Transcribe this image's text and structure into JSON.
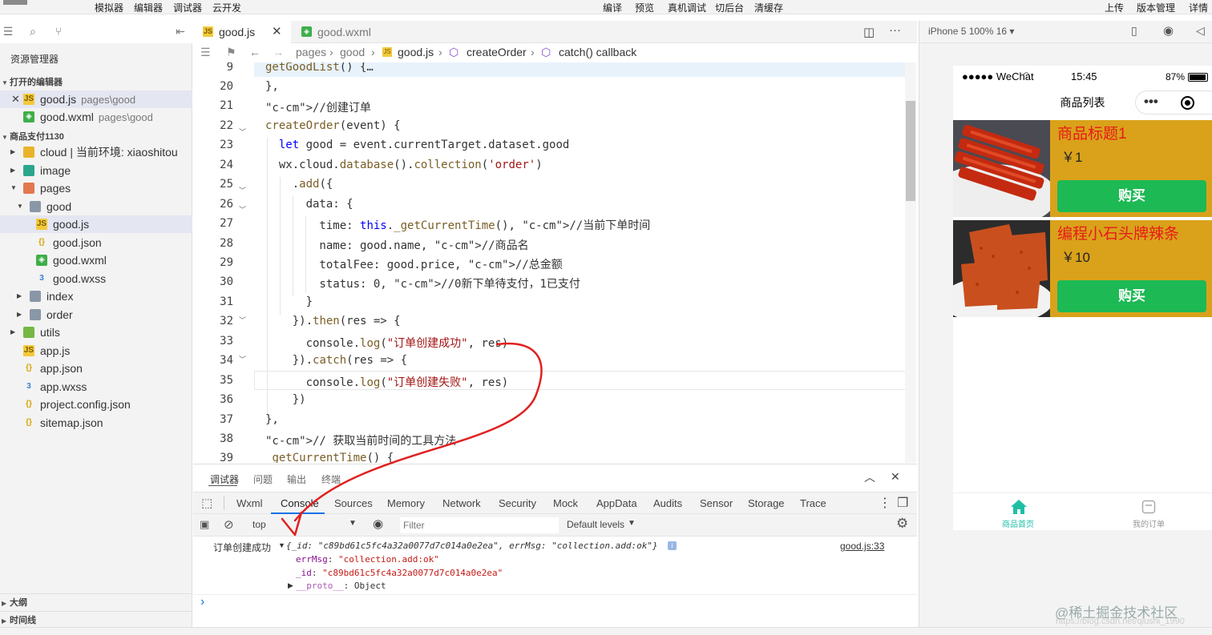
{
  "menu": [
    "模拟器",
    "编辑器",
    "调试器",
    "云开发",
    "编译",
    "预览",
    "真机调试",
    "切后台",
    "清缓存",
    "上传",
    "版本管理",
    "详情"
  ],
  "explorer": {
    "title": "资源管理器",
    "open_editors_label": "打开的编辑器",
    "open_editors": [
      {
        "name": "good.js",
        "path": "pages\\good"
      },
      {
        "name": "good.wxml",
        "path": "pages\\good"
      }
    ],
    "project_label": "商品支付1130",
    "tree": [
      "cloud | 当前环境: xiaoshitou",
      "image",
      "pages",
      "good",
      "good.js",
      "good.json",
      "good.wxml",
      "good.wxss",
      "index",
      "order",
      "utils",
      "app.js",
      "app.json",
      "app.wxss",
      "project.config.json",
      "sitemap.json"
    ],
    "outline_label": "大纲",
    "timeline_label": "时间线"
  },
  "editor": {
    "tabs": [
      {
        "label": "good.js"
      },
      {
        "label": "good.wxml"
      }
    ],
    "breadcrumb": [
      "pages",
      "good",
      "good.js",
      "createOrder",
      "catch() callback"
    ],
    "line_numbers": [
      "9",
      "20",
      "21",
      "22",
      "23",
      "24",
      "25",
      "26",
      "27",
      "28",
      "29",
      "30",
      "31",
      "32",
      "33",
      "34",
      "35",
      "36",
      "37",
      "38",
      "39"
    ],
    "lines": [
      "getGoodList() {…",
      "},",
      "//创建订单",
      "createOrder(event) {",
      "  let good = event.currentTarget.dataset.good",
      "  wx.cloud.database().collection('order')",
      "    .add({",
      "      data: {",
      "        time: this._getCurrentTime(), //当前下单时间",
      "        name: good.name, //商品名",
      "        totalFee: good.price, //总金额",
      "        status: 0, //0新下单待支付，1已支付",
      "      }",
      "    }).then(res => {",
      "      console.log(\"订单创建成功\", res)",
      "    }).catch(res => {",
      "      console.log(\"订单创建失败\", res)",
      "    })",
      "},",
      "// 获取当前时间的工具方法",
      " getCurrentTime() {"
    ]
  },
  "debugger": {
    "top_tabs": [
      "调试器",
      "问题",
      "输出",
      "终端"
    ],
    "tabs": [
      "Wxml",
      "Console",
      "Sources",
      "Memory",
      "Network",
      "Security",
      "Mock",
      "AppData",
      "Audits",
      "Sensor",
      "Storage",
      "Trace"
    ],
    "context": "top",
    "filter_placeholder": "Filter",
    "levels": "Default levels",
    "log_label": "订单创建成功",
    "log_object": "{_id: \"c89bd61c5fc4a32a0077d7c014a0e2ea\", errMsg: \"collection.add:ok\"}",
    "source": "good.js:33",
    "props": [
      {
        "key": "errMsg",
        "value": "\"collection.add:ok\""
      },
      {
        "key": "_id",
        "value": "\"c89bd61c5fc4a32a0077d7c014a0e2ea\""
      },
      {
        "key": "__proto__",
        "value": "Object"
      }
    ],
    "prompt": "›"
  },
  "simulator": {
    "device": "iPhone 5 100% 16 ▾",
    "carrier": "●●●●● WeChat",
    "time": "15:45",
    "battery": "87%",
    "page_title": "商品列表",
    "products": [
      {
        "title": "商品标题1",
        "price": "￥1",
        "button": "购买"
      },
      {
        "title": "编程小石头牌辣条",
        "price": "￥10",
        "button": "购买"
      }
    ],
    "tabbar": [
      {
        "label": "商品首页",
        "color": "#1fbfa6"
      },
      {
        "label": "我的订单",
        "color": "#999999"
      }
    ]
  },
  "watermark": "@稀土掘金技术社区",
  "watermark_url": "https://blog.csdn.net/qiushi_1990",
  "colors": {
    "accent_green": "#1db954",
    "product_bg": "#d9a21a",
    "annotation_red": "#e02020"
  }
}
